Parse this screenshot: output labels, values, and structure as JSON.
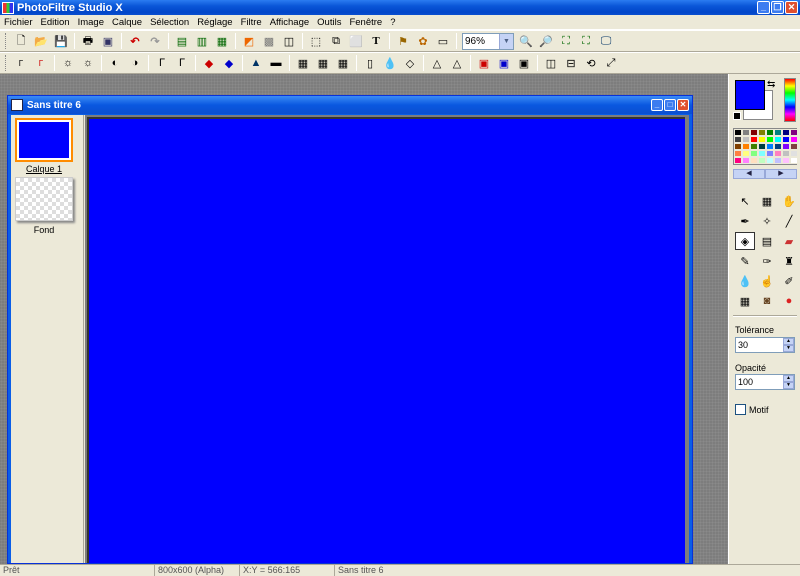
{
  "app": {
    "title": "PhotoFiltre Studio X"
  },
  "menu": [
    "Fichier",
    "Edition",
    "Image",
    "Calque",
    "Sélection",
    "Réglage",
    "Filtre",
    "Affichage",
    "Outils",
    "Fenêtre",
    "?"
  ],
  "toolbar": {
    "zoom_value": "96%"
  },
  "document": {
    "title": "Sans titre 6",
    "canvas_color": "#0000ff",
    "layers": [
      {
        "name": "Calque 1"
      },
      {
        "name": "Fond"
      }
    ]
  },
  "panel": {
    "fg_color": "#0000ff",
    "bg_color": "#ffffff",
    "tolerance_label": "Tolérance",
    "tolerance_value": "30",
    "opacity_label": "Opacité",
    "opacity_value": "100",
    "motif_label": "Motif"
  },
  "palette_colors": [
    "#000000",
    "#808080",
    "#800000",
    "#808000",
    "#008000",
    "#008080",
    "#000080",
    "#800080",
    "#404040",
    "#c0c0c0",
    "#ff0000",
    "#ffff00",
    "#00ff00",
    "#00ffff",
    "#0000ff",
    "#ff00ff",
    "#804000",
    "#ff8000",
    "#408000",
    "#004040",
    "#0080ff",
    "#004080",
    "#8000ff",
    "#804040",
    "#ff8040",
    "#ffff80",
    "#80ff80",
    "#80ffff",
    "#8080ff",
    "#ff80c0",
    "#c0c0c0",
    "#e0e0e0",
    "#ff0080",
    "#ff80ff",
    "#ffe0c0",
    "#c0ffc0",
    "#c0ffff",
    "#c0c0ff",
    "#ffc0ff",
    "#ffffff"
  ],
  "status": {
    "state": "Prêt",
    "size": "800x600 (Alpha)",
    "coords": "X:Y = 566:165",
    "doc": "Sans titre 6"
  }
}
